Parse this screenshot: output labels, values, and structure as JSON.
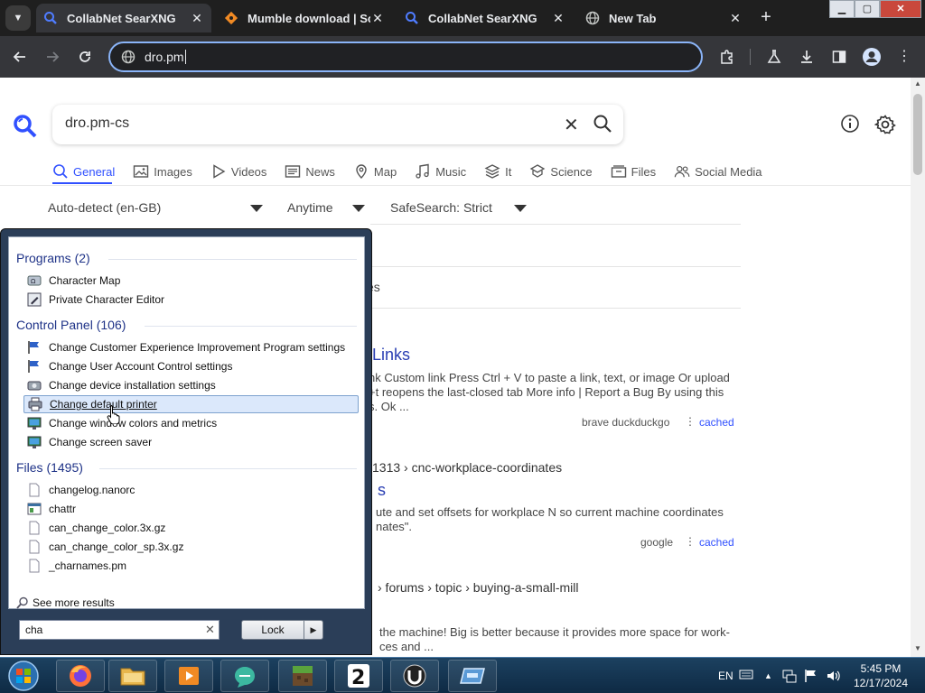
{
  "browser": {
    "tabs": [
      {
        "title": "CollabNet SearXNG",
        "active": true
      },
      {
        "title": "Mumble download | So",
        "active": false
      },
      {
        "title": "CollabNet SearXNG",
        "active": false
      },
      {
        "title": "New Tab",
        "active": false
      }
    ],
    "address": "dro.pm"
  },
  "searxng": {
    "query": "dro.pm-cs",
    "categories": [
      {
        "label": "General",
        "icon": "search-icon",
        "active": true
      },
      {
        "label": "Images",
        "icon": "image-icon"
      },
      {
        "label": "Videos",
        "icon": "play-icon"
      },
      {
        "label": "News",
        "icon": "newspaper-icon"
      },
      {
        "label": "Map",
        "icon": "map-pin-icon"
      },
      {
        "label": "Music",
        "icon": "music-icon"
      },
      {
        "label": "It",
        "icon": "layers-icon"
      },
      {
        "label": "Science",
        "icon": "science-icon"
      },
      {
        "label": "Files",
        "icon": "files-icon"
      },
      {
        "label": "Social Media",
        "icon": "people-icon"
      }
    ],
    "filters": {
      "language": "Auto-detect (en-GB)",
      "time": "Anytime",
      "safesearch": "SafeSearch: Strict"
    },
    "partial": {
      "row2_fragment": "es",
      "result1": {
        "title_fragment": "Links",
        "snippet": [
          "nk Custom link Press Ctrl + V to paste a link, text, or image Or upload",
          "+t reopens the last-closed tab More info | Report a Bug By using this",
          "s. Ok ..."
        ],
        "engines": "brave  duckduckgo",
        "cached": "cached"
      },
      "result2": {
        "url_fragment": "1313 › cnc-workplace-coordinates",
        "title_fragment": "s",
        "snippet": [
          "ute and set offsets for workplace N so current machine coordinates",
          "nates\"."
        ],
        "engines": "google",
        "cached": "cached"
      },
      "result3": {
        "url_fragment": "› forums › topic › buying-a-small-mill",
        "snippet": [
          "the machine! Big is better because it provides more space for work-",
          "ces and ..."
        ]
      }
    }
  },
  "start_menu": {
    "groups": [
      {
        "heading": "Programs (2)",
        "items": [
          {
            "label": "Character Map",
            "icon": "character-map-icon"
          },
          {
            "label": "Private Character Editor",
            "icon": "char-editor-icon"
          }
        ]
      },
      {
        "heading": "Control Panel (106)",
        "items": [
          {
            "label": "Change Customer Experience Improvement Program settings",
            "icon": "flag-icon"
          },
          {
            "label": "Change User Account Control settings",
            "icon": "flag-icon"
          },
          {
            "label": "Change device installation settings",
            "icon": "device-icon"
          },
          {
            "label": "Change default printer",
            "icon": "printer-icon",
            "selected": true
          },
          {
            "label": "Change window colors and metrics",
            "icon": "monitor-icon"
          },
          {
            "label": "Change screen saver",
            "icon": "monitor-icon"
          }
        ]
      },
      {
        "heading": "Files (1495)",
        "items": [
          {
            "label": "changelog.nanorc",
            "icon": "file-icon"
          },
          {
            "label": "chattr",
            "icon": "app-file-icon"
          },
          {
            "label": "can_change_color.3x.gz",
            "icon": "file-icon"
          },
          {
            "label": "can_change_color_sp.3x.gz",
            "icon": "file-icon"
          },
          {
            "label": "_charnames.pm",
            "icon": "file-icon"
          }
        ]
      }
    ],
    "see_more": "See more results",
    "search_value": "cha",
    "lock_label": "Lock"
  },
  "taskbar": {
    "language": "EN",
    "time": "5:45 PM",
    "date": "12/17/2024"
  }
}
